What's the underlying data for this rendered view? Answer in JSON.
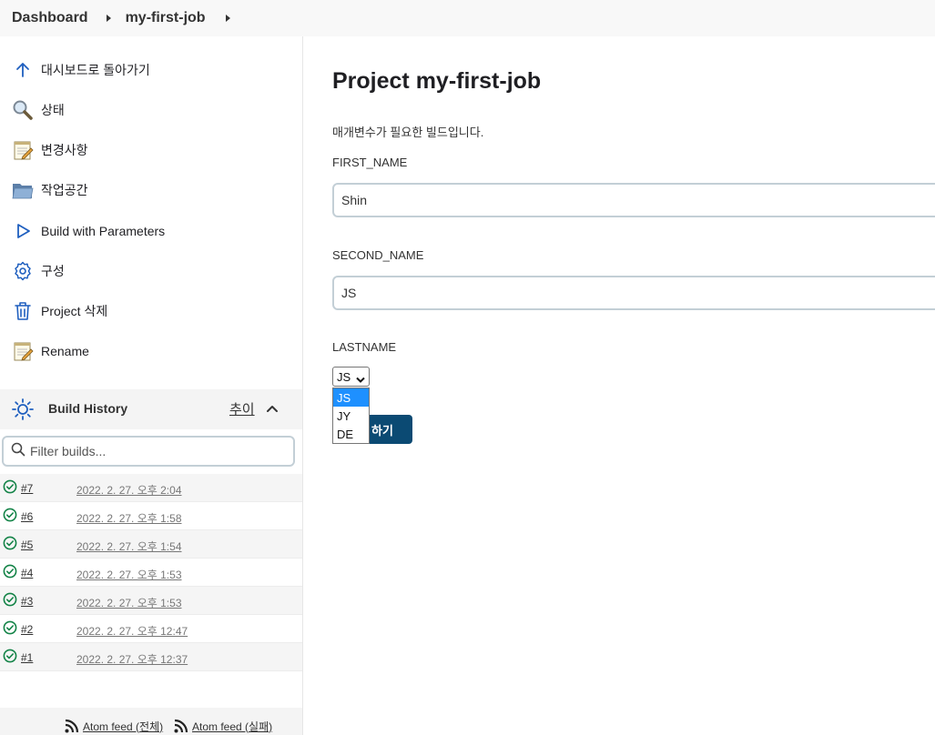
{
  "breadcrumb": {
    "dashboard": "Dashboard",
    "job": "my-first-job"
  },
  "sidebar": {
    "tasks": [
      {
        "label": "대시보드로 돌아가기",
        "icon": "arrow-up-icon"
      },
      {
        "label": "상태",
        "icon": "magnifier-icon"
      },
      {
        "label": "변경사항",
        "icon": "notepad-icon"
      },
      {
        "label": "작업공간",
        "icon": "folder-icon"
      },
      {
        "label": "Build with Parameters",
        "icon": "play-icon"
      },
      {
        "label": "구성",
        "icon": "gear-icon"
      },
      {
        "label": "Project 삭제",
        "icon": "trash-icon"
      },
      {
        "label": "Rename",
        "icon": "notepad-icon"
      }
    ],
    "build_history": {
      "title": "Build History",
      "trend": "추이",
      "filter_placeholder": "Filter builds...",
      "builds": [
        {
          "num": "#7",
          "time": "2022. 2. 27. 오후 2:04"
        },
        {
          "num": "#6",
          "time": "2022. 2. 27. 오후 1:58"
        },
        {
          "num": "#5",
          "time": "2022. 2. 27. 오후 1:54"
        },
        {
          "num": "#4",
          "time": "2022. 2. 27. 오후 1:53"
        },
        {
          "num": "#3",
          "time": "2022. 2. 27. 오후 1:53"
        },
        {
          "num": "#2",
          "time": "2022. 2. 27. 오후 12:47"
        },
        {
          "num": "#1",
          "time": "2022. 2. 27. 오후 12:37"
        }
      ],
      "feed_all": "Atom feed (전체)",
      "feed_failed": "Atom feed (실패)"
    }
  },
  "main": {
    "title": "Project my-first-job",
    "description": "매개변수가 필요한 빌드입니다.",
    "params": {
      "first_name": {
        "label": "FIRST_NAME",
        "value": "Shin"
      },
      "second_name": {
        "label": "SECOND_NAME",
        "value": "JS"
      },
      "lastname": {
        "label": "LASTNAME",
        "selected": "JS",
        "options": [
          "JS",
          "JY",
          "DE"
        ]
      }
    },
    "build_button": "하기"
  },
  "colors": {
    "accent": "#0b4a73",
    "success": "#138347",
    "link_blue": "#1f5fbf",
    "selection": "#1e90ff"
  }
}
